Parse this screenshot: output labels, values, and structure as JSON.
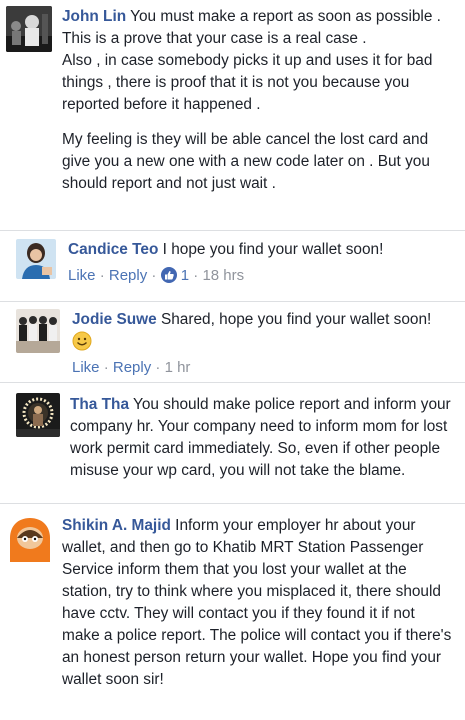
{
  "comments": [
    {
      "author": "John Lin",
      "paragraphs": [
        " You must make a report as soon as possible . This is a prove that your case is a real case .",
        "Also , in case somebody picks it up and uses it for bad things , there is proof that it is not you because you reported before it happened .",
        "My feeling is they will be able cancel the lost card and give you a new one with a new code later on . But you should report and not just wait ."
      ]
    },
    {
      "author": "Candice Teo",
      "text": " I hope you find your wallet soon!",
      "like_label": "Like",
      "reply_label": "Reply",
      "reaction_count": "1",
      "time": "18 hrs"
    },
    {
      "author": "Jodie Suwe",
      "text": " Shared, hope you find your wallet soon!",
      "like_label": "Like",
      "reply_label": "Reply",
      "time": "1 hr"
    },
    {
      "author": "Tha Tha",
      "text": " You should make police report and inform your company hr. Your company need to inform mom for lost work permit card immediately. So, even if other people misuse your wp card, you will not take the blame."
    },
    {
      "author": "Shikin A. Majid",
      "text": " Inform your employer hr about your wallet, and then go to Khatib MRT Station Passenger Service inform them that you lost your wallet at the station, try to think where you misplaced it, there should have cctv. They will contact you if they found it if not make a police report. The police will contact you if there's an honest person return your wallet. Hope you find your wallet soon sir!"
    }
  ],
  "separator": "·",
  "colors": {
    "name": "#365899",
    "link": "#4b73b4",
    "meta": "#90949c",
    "text": "#1d2129"
  }
}
